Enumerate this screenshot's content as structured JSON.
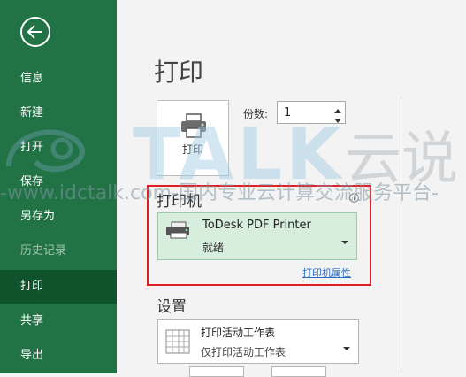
{
  "sidebar": {
    "items": [
      {
        "label": "信息"
      },
      {
        "label": "新建"
      },
      {
        "label": "打开"
      },
      {
        "label": "保存"
      },
      {
        "label": "另存为"
      },
      {
        "label": "历史记录"
      },
      {
        "label": "打印"
      },
      {
        "label": "共享"
      },
      {
        "label": "导出"
      }
    ]
  },
  "main": {
    "title": "打印",
    "print_button": "打印",
    "copies_label": "份数:",
    "copies_value": "1",
    "printer_section": "打印机",
    "printer": {
      "name": "ToDesk PDF Printer",
      "status": "就绪"
    },
    "printer_properties": "打印机属性",
    "settings_section": "设置",
    "settings": {
      "title": "打印活动工作表",
      "subtitle": "仅打印活动工作表"
    }
  },
  "watermark": {
    "brand": "TALK",
    "brand_cn": "云说",
    "url_text": "-www.idctalk.com-国内专业云计算交流服务平台-"
  },
  "colors": {
    "sidebar": "#217346",
    "sidebar_active": "#10522c",
    "highlight_frame": "#e31c23",
    "printer_selected": "#d7eedd"
  }
}
